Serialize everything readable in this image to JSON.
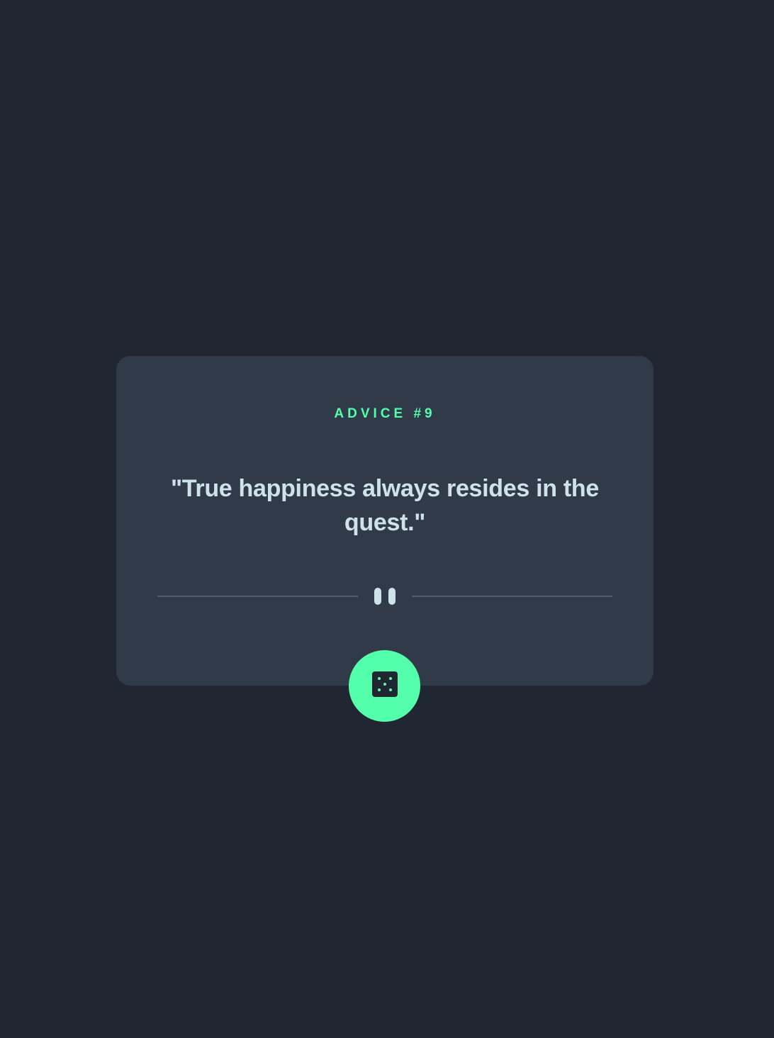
{
  "advice": {
    "id_label": "ADVICE #9",
    "text": "\"True happiness always resides in the quest.\""
  },
  "divider": {
    "icon": "pause-icon"
  },
  "dice_button": {
    "icon": "dice-icon"
  },
  "colors": {
    "background": "#202632",
    "card": "#313a49",
    "accent": "#53ffaa",
    "text": "#cee3e9",
    "divider": "#4f5d74"
  }
}
